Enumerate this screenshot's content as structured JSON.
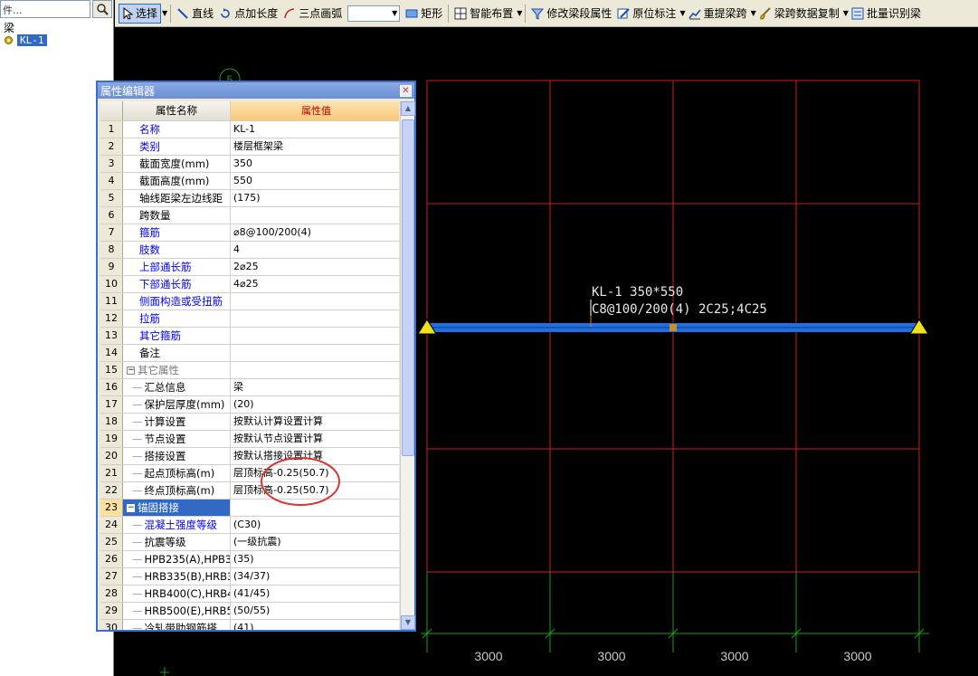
{
  "left_tree": {
    "search_value": "件...",
    "root_label": "梁",
    "node_label": "KL-1"
  },
  "toolbar": {
    "select": "选择",
    "line": "直线",
    "point_length": "点加长度",
    "three_point_arc": "三点画弧",
    "rect": "矩形",
    "smart_layout": "智能布置",
    "edit_span_props": "修改梁段属性",
    "in_situ_annot": "原位标注",
    "re_extract_span": "重提梁跨",
    "span_data_copy": "梁跨数据复制",
    "batch_identify": "批量识别梁"
  },
  "prop_editor": {
    "title": "属性编辑器",
    "col_name": "属性名称",
    "col_value": "属性值",
    "rows": [
      {
        "num": "1",
        "name": "名称",
        "value": "KL-1"
      },
      {
        "num": "2",
        "name": "类别",
        "value": "楼层框架梁"
      },
      {
        "num": "3",
        "name": "截面宽度(mm)",
        "value": "350"
      },
      {
        "num": "4",
        "name": "截面高度(mm)",
        "value": "550"
      },
      {
        "num": "5",
        "name": "轴线距梁左边线距",
        "value": "(175)"
      },
      {
        "num": "6",
        "name": "跨数量",
        "value": ""
      },
      {
        "num": "7",
        "name": "箍筋",
        "value": "⌀8@100/200(4)"
      },
      {
        "num": "8",
        "name": "肢数",
        "value": "4"
      },
      {
        "num": "9",
        "name": "上部通长筋",
        "value": "2⌀25"
      },
      {
        "num": "10",
        "name": "下部通长筋",
        "value": "4⌀25"
      },
      {
        "num": "11",
        "name": "侧面构造或受扭筋",
        "value": ""
      },
      {
        "num": "12",
        "name": "拉筋",
        "value": ""
      },
      {
        "num": "13",
        "name": "其它箍筋",
        "value": ""
      },
      {
        "num": "14",
        "name": "备注",
        "value": ""
      },
      {
        "num": "15",
        "name": "其它属性",
        "value": ""
      },
      {
        "num": "16",
        "name": "汇总信息",
        "value": "梁"
      },
      {
        "num": "17",
        "name": "保护层厚度(mm)",
        "value": "(20)"
      },
      {
        "num": "18",
        "name": "计算设置",
        "value": "按默认计算设置计算"
      },
      {
        "num": "19",
        "name": "节点设置",
        "value": "按默认节点设置计算"
      },
      {
        "num": "20",
        "name": "搭接设置",
        "value": "按默认搭接设置计算"
      },
      {
        "num": "21",
        "name": "起点顶标高(m)",
        "value": "层顶标高-0.25(50.7)"
      },
      {
        "num": "22",
        "name": "终点顶标高(m)",
        "value": "层顶标高-0.25(50.7)"
      },
      {
        "num": "23",
        "name": "锚固搭接",
        "value": ""
      },
      {
        "num": "24",
        "name": "混凝土强度等级",
        "value": "(C30)"
      },
      {
        "num": "25",
        "name": "抗震等级",
        "value": "(一级抗震)"
      },
      {
        "num": "26",
        "name": "HPB235(A),HPB3",
        "value": "(35)"
      },
      {
        "num": "27",
        "name": "HRB335(B),HRB3",
        "value": "(34/37)"
      },
      {
        "num": "28",
        "name": "HRB400(C),HRB4",
        "value": "(41/45)"
      },
      {
        "num": "29",
        "name": "HRB500(E),HRB5",
        "value": "(50/55)"
      },
      {
        "num": "30",
        "name": "冷轧带肋钢筋搭",
        "value": "(41)"
      }
    ]
  },
  "canvas": {
    "beam_label_line1": "KL-1 350*550",
    "beam_label_line2": "C8@100/200(4) 2C25;4C25",
    "axis_marker": "5",
    "dimensions": [
      "3000",
      "3000",
      "3000",
      "3000"
    ]
  }
}
